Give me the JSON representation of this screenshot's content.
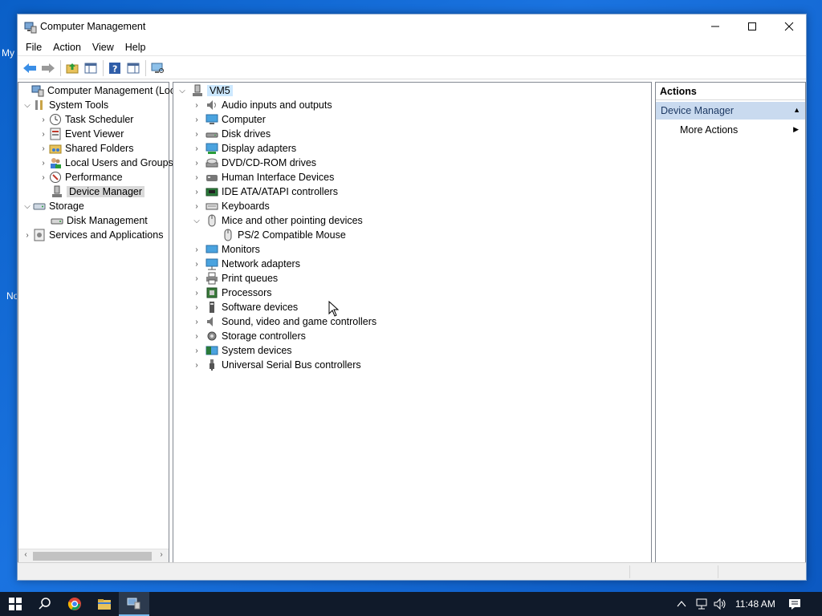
{
  "window": {
    "title": "Computer Management",
    "controls": {
      "minimize": "—",
      "maximize": "☐",
      "close": "✕"
    }
  },
  "menu": [
    "File",
    "Action",
    "View",
    "Help"
  ],
  "left_tree": {
    "root": "Computer Management (Local",
    "system_tools": "System Tools",
    "task_scheduler": "Task Scheduler",
    "event_viewer": "Event Viewer",
    "shared_folders": "Shared Folders",
    "local_users": "Local Users and Groups",
    "performance": "Performance",
    "device_manager": "Device Manager",
    "storage": "Storage",
    "disk_management": "Disk Management",
    "services": "Services and Applications"
  },
  "device_tree": {
    "root": "VM5",
    "categories": [
      "Audio inputs and outputs",
      "Computer",
      "Disk drives",
      "Display adapters",
      "DVD/CD-ROM drives",
      "Human Interface Devices",
      "IDE ATA/ATAPI controllers",
      "Keyboards",
      "Mice and other pointing devices",
      "PS/2 Compatible Mouse",
      "Monitors",
      "Network adapters",
      "Print queues",
      "Processors",
      "Software devices",
      "Sound, video and game controllers",
      "Storage controllers",
      "System devices",
      "Universal Serial Bus controllers"
    ]
  },
  "actions": {
    "header": "Actions",
    "section": "Device Manager",
    "more": "More Actions"
  },
  "taskbar": {
    "time": "11:48 AM"
  },
  "desktop": {
    "edge_labels": [
      "My",
      "No"
    ]
  },
  "colors": {
    "accent": "#0078d7",
    "desktop": "#0a5fc7",
    "taskbar": "#101a2a",
    "selection": "#cce8ff"
  }
}
